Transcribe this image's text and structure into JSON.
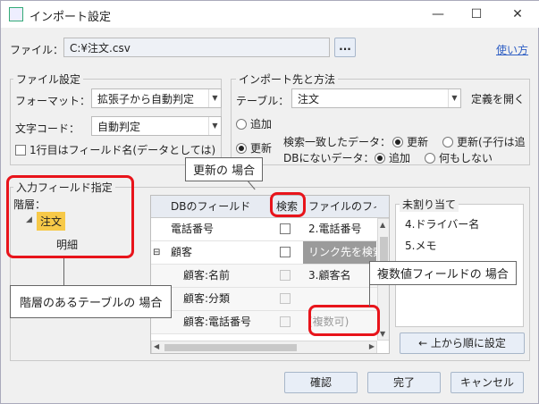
{
  "window": {
    "title": "インポート設定",
    "minimize": "—",
    "maximize": "☐",
    "close": "✕"
  },
  "file": {
    "label": "ファイル：",
    "value": "C:¥注文.csv",
    "browse": "...",
    "help_link": "使い方"
  },
  "file_settings": {
    "title": "ファイル設定",
    "format_label": "フォーマット：",
    "format_value": "拡張子から自動判定",
    "encoding_label": "文字コード：",
    "encoding_value": "自動判定",
    "header_checkbox": "1行目はフィールド名(データとしては)"
  },
  "import_target": {
    "title": "インポート先と方法",
    "table_label": "テーブル：",
    "table_value": "注文",
    "define_link": "定義を開く",
    "append": "追加",
    "update": "更新",
    "match_label": "検索一致したデータ：",
    "match_update": "更新",
    "match_update_child": "更新(子行は追",
    "nodb_label": "DBにないデータ：",
    "nodb_add": "追加",
    "nodb_none": "何もしない"
  },
  "input_fields": {
    "title": "入力フィールド指定",
    "hierarchy_label": "階層：",
    "tree": {
      "root": "注文",
      "child": "明細"
    }
  },
  "grid": {
    "headers": {
      "db_field": "DBのフィールド",
      "search": "検索",
      "file_field": "ファイルのフィ"
    },
    "rows": [
      {
        "db": "電話番号",
        "file": "2.電話番号",
        "expander": ""
      },
      {
        "db": "顧客",
        "file": "リンク先を検索",
        "expander": "⊟"
      },
      {
        "db": "顧客:名前",
        "file": "3.顧客名",
        "expander": ""
      },
      {
        "db": "顧客:分類",
        "file": "",
        "expander": ""
      },
      {
        "db": "顧客:電話番号",
        "file": "(複数可)",
        "expander": ""
      }
    ]
  },
  "unassigned": {
    "title": "未割り当て",
    "items": [
      "4.ドライバー名",
      "5.メモ"
    ],
    "set_button": "← 上から順に設定"
  },
  "callouts": {
    "update": "更新の 場合",
    "hierarchy": "階層のあるテーブルの 場合",
    "multi": "複数値フィールドの 場合"
  },
  "buttons": {
    "confirm": "確認",
    "done": "完了",
    "cancel": "キャンセル"
  },
  "colors": {
    "highlight": "#e8141b",
    "tree_selected": "#f7c948",
    "link_row": "#9b9b9b"
  }
}
